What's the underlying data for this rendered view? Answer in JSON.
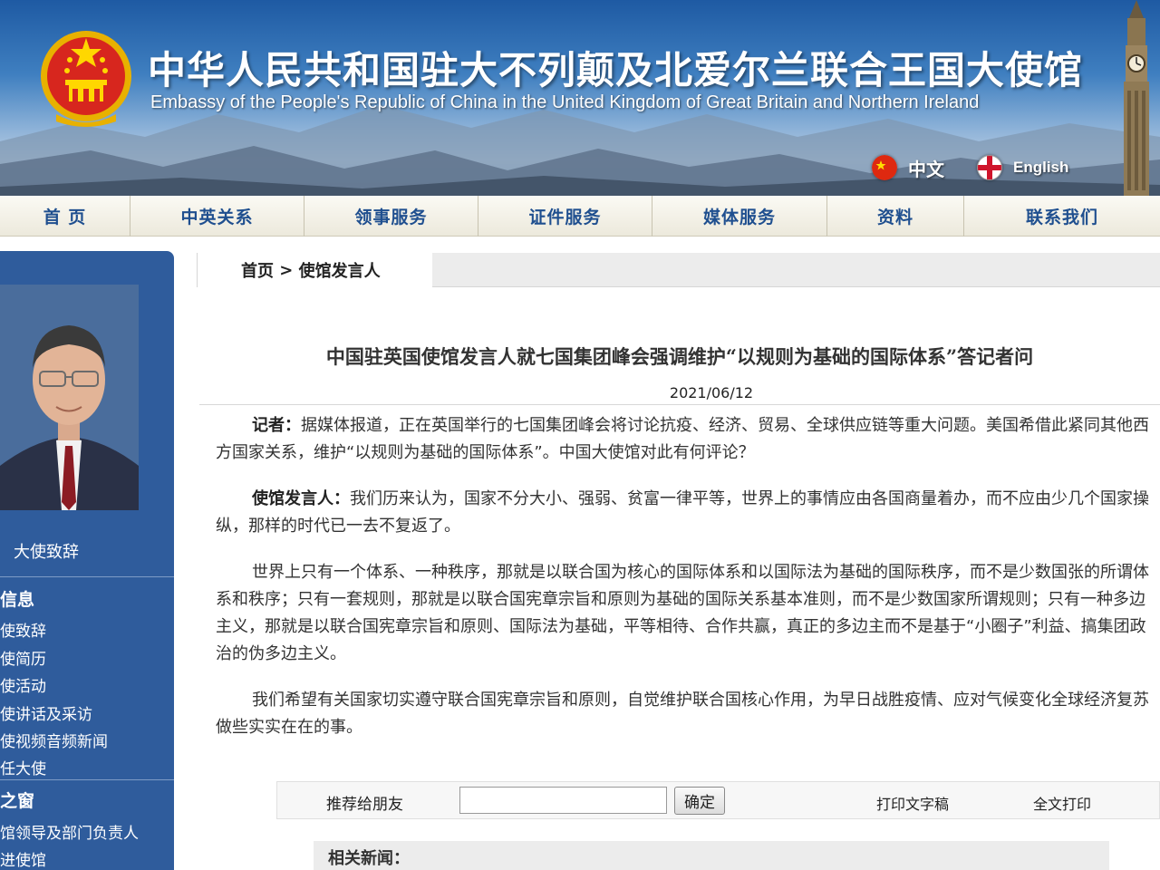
{
  "header": {
    "title_cn": "中华人民共和国驻大不列颠及北爱尔兰联合王国大使馆",
    "title_en": "Embassy of the People's Republic of China in the United Kingdom of Great Britain and Northern Ireland",
    "lang_cn": "中文",
    "lang_en": "English"
  },
  "nav": {
    "items": [
      {
        "label": "首 页"
      },
      {
        "label": "中英关系"
      },
      {
        "label": "领事服务"
      },
      {
        "label": "证件服务"
      },
      {
        "label": "媒体服务"
      },
      {
        "label": "资料"
      },
      {
        "label": "联系我们"
      }
    ]
  },
  "sidebar": {
    "photo_caption": "大使致辞",
    "section1_head": "信息",
    "section1_links": [
      "使致辞",
      "使简历",
      "使活动",
      "使讲话及采访",
      "使视频音频新闻",
      "任大使"
    ],
    "section2_head": "之窗",
    "section2_links": [
      "馆领导及部门负责人",
      "进使馆"
    ]
  },
  "breadcrumb": {
    "home": "首页",
    "separator": " > ",
    "current": "使馆发言人"
  },
  "article": {
    "title": "中国驻英国使馆发言人就七国集团峰会强调维护“以规则为基础的国际体系”答记者问",
    "date": "2021/06/12",
    "q_label": "记者：",
    "q_text": "据媒体报道，正在英国举行的七国集团峰会将讨论抗疫、经济、贸易、全球供应链等重大问题。美国希借此紧同其他西方国家关系，维护“以规则为基础的国际体系”。中国大使馆对此有何评论？",
    "a_label": "使馆发言人：",
    "a_text": "我们历来认为，国家不分大小、强弱、贫富一律平等，世界上的事情应由各国商量着办，而不应由少几个国家操纵，那样的时代已一去不复返了。",
    "p3": "世界上只有一个体系、一种秩序，那就是以联合国为核心的国际体系和以国际法为基础的国际秩序，而不是少数国张的所谓体系和秩序；只有一套规则，那就是以联合国宪章宗旨和原则为基础的国际关系基本准则，而不是少数国家所谓规则；只有一种多边主义，那就是以联合国宪章宗旨和原则、国际法为基础，平等相待、合作共赢，真正的多边主而不是基于“小圈子”利益、搞集团政治的伪多边主义。",
    "p4": "我们希望有关国家切实遵守联合国宪章宗旨和原则，自觉维护联合国核心作用，为早日战胜疫情、应对气候变化全球经济复苏做些实实在在的事。"
  },
  "share": {
    "label": "推荐给朋友",
    "input_value": "",
    "confirm": "确定",
    "print_text": "打印文字稿",
    "print_full": "全文打印"
  },
  "related": {
    "title": "相关新闻："
  },
  "colors": {
    "sidebar": "#2f5c9c",
    "nav_text": "#1f4f8f",
    "flag_red": "#de2910",
    "flag_gold": "#ffde00"
  }
}
